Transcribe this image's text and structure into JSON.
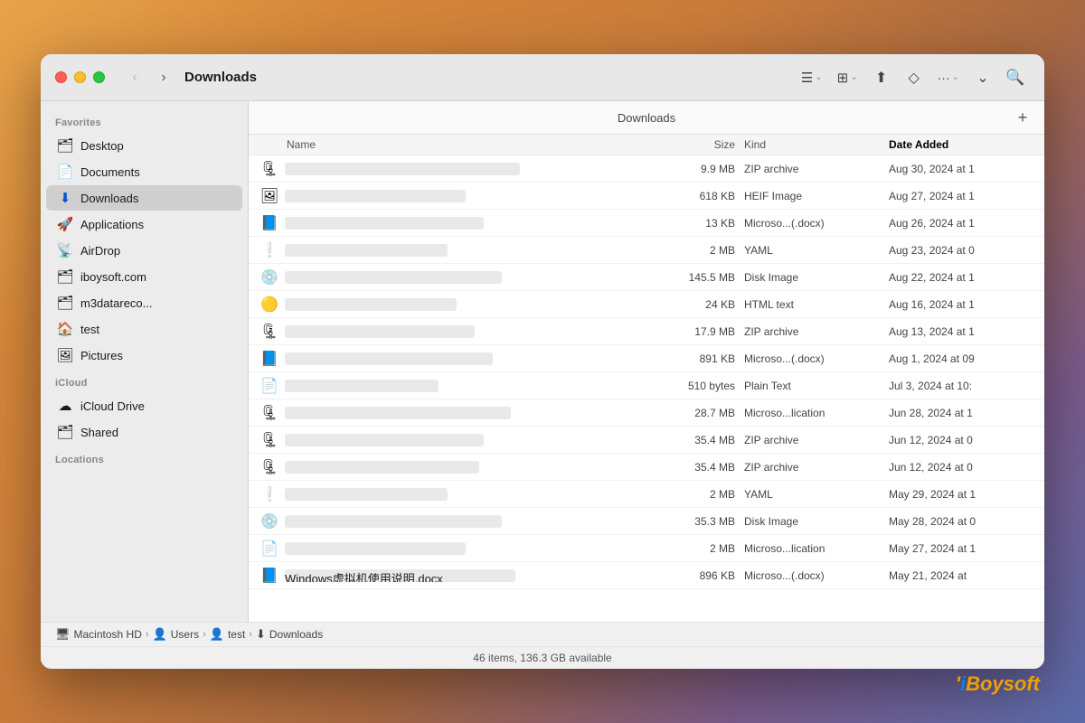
{
  "window": {
    "title": "Downloads",
    "folder_label": "Downloads",
    "status": "46 items, 136.3 GB available"
  },
  "toolbar": {
    "back_label": "‹",
    "forward_label": "›",
    "list_view_icon": "☰",
    "grid_view_icon": "⊞",
    "share_icon": "⬆",
    "tag_icon": "◇",
    "more_icon": "…",
    "chevron_icon": "⌄",
    "search_icon": "⌕",
    "add_icon": "+"
  },
  "sidebar": {
    "favorites_label": "Favorites",
    "icloud_label": "iCloud",
    "locations_label": "Locations",
    "items": [
      {
        "id": "desktop",
        "label": "Desktop",
        "icon": "🗂"
      },
      {
        "id": "documents",
        "label": "Documents",
        "icon": "📄"
      },
      {
        "id": "downloads",
        "label": "Downloads",
        "icon": "⬇",
        "active": true
      },
      {
        "id": "applications",
        "label": "Applications",
        "icon": "🚀"
      },
      {
        "id": "airdrop",
        "label": "AirDrop",
        "icon": "📡"
      },
      {
        "id": "iboysoft",
        "label": "iboysoft.com",
        "icon": "🗂"
      },
      {
        "id": "m3datareco",
        "label": "m3datareco...",
        "icon": "🗂"
      },
      {
        "id": "test",
        "label": "test",
        "icon": "🏠"
      },
      {
        "id": "pictures",
        "label": "Pictures",
        "icon": "🖼"
      },
      {
        "id": "icloud-drive",
        "label": "iCloud Drive",
        "icon": "☁"
      },
      {
        "id": "shared",
        "label": "Shared",
        "icon": "🗂"
      }
    ]
  },
  "columns": {
    "name": "Name",
    "size": "Size",
    "kind": "Kind",
    "date": "Date Added"
  },
  "files": [
    {
      "icon": "🗜",
      "size": "9.9 MB",
      "kind": "ZIP archive",
      "date": "Aug 30, 2024 at 1",
      "name_width": "260"
    },
    {
      "icon": "🖼",
      "size": "618 KB",
      "kind": "HEIF Image",
      "date": "Aug 27, 2024 at 1",
      "name_width": "200"
    },
    {
      "icon": "📘",
      "size": "13 KB",
      "kind": "Microso...(.docx)",
      "date": "Aug 26, 2024 at 1",
      "name_width": "220"
    },
    {
      "icon": "❕",
      "size": "2 MB",
      "kind": "YAML",
      "date": "Aug 23, 2024 at 0",
      "name_width": "180"
    },
    {
      "icon": "💿",
      "size": "145.5 MB",
      "kind": "Disk Image",
      "date": "Aug 22, 2024 at 1",
      "name_width": "240"
    },
    {
      "icon": "🟡",
      "size": "24 KB",
      "kind": "HTML text",
      "date": "Aug 16, 2024 at 1",
      "name_width": "190"
    },
    {
      "icon": "🗜",
      "size": "17.9 MB",
      "kind": "ZIP archive",
      "date": "Aug 13, 2024 at 1",
      "name_width": "210"
    },
    {
      "icon": "📘",
      "size": "891 KB",
      "kind": "Microso...(.docx)",
      "date": "Aug 1, 2024 at 09",
      "name_width": "230"
    },
    {
      "icon": "📄",
      "size": "510 bytes",
      "kind": "Plain Text",
      "date": "Jul 3, 2024 at 10:",
      "name_width": "170"
    },
    {
      "icon": "🗜",
      "size": "28.7 MB",
      "kind": "Microso...lication",
      "date": "Jun 28, 2024 at 1",
      "name_width": "250"
    },
    {
      "icon": "🗜",
      "size": "35.4 MB",
      "kind": "ZIP archive",
      "date": "Jun 12, 2024 at 0",
      "name_width": "220"
    },
    {
      "icon": "🗜",
      "size": "35.4 MB",
      "kind": "ZIP archive",
      "date": "Jun 12, 2024 at 0",
      "name_width": "215"
    },
    {
      "icon": "❕",
      "size": "2 MB",
      "kind": "YAML",
      "date": "May 29, 2024 at 1",
      "name_width": "180"
    },
    {
      "icon": "💿",
      "size": "35.3 MB",
      "kind": "Disk Image",
      "date": "May 28, 2024 at 0",
      "name_width": "240"
    },
    {
      "icon": "📄",
      "size": "2 MB",
      "kind": "Microso...lication",
      "date": "May 27, 2024 at 1",
      "name_width": "200"
    },
    {
      "icon": "📘",
      "label": "Windows虚拟机使用说明.docx",
      "size": "896 KB",
      "kind": "Microso...(.docx)",
      "date": "May 21, 2024 at",
      "name_width": "255"
    }
  ],
  "breadcrumb": {
    "items": [
      {
        "label": "Macintosh HD",
        "icon": "🖥"
      },
      {
        "label": "Users",
        "icon": "👤"
      },
      {
        "label": "test",
        "icon": "👤"
      },
      {
        "label": "Downloads",
        "icon": "⬇"
      }
    ]
  },
  "watermark": {
    "prefix": "i",
    "text": "Boysoft"
  }
}
